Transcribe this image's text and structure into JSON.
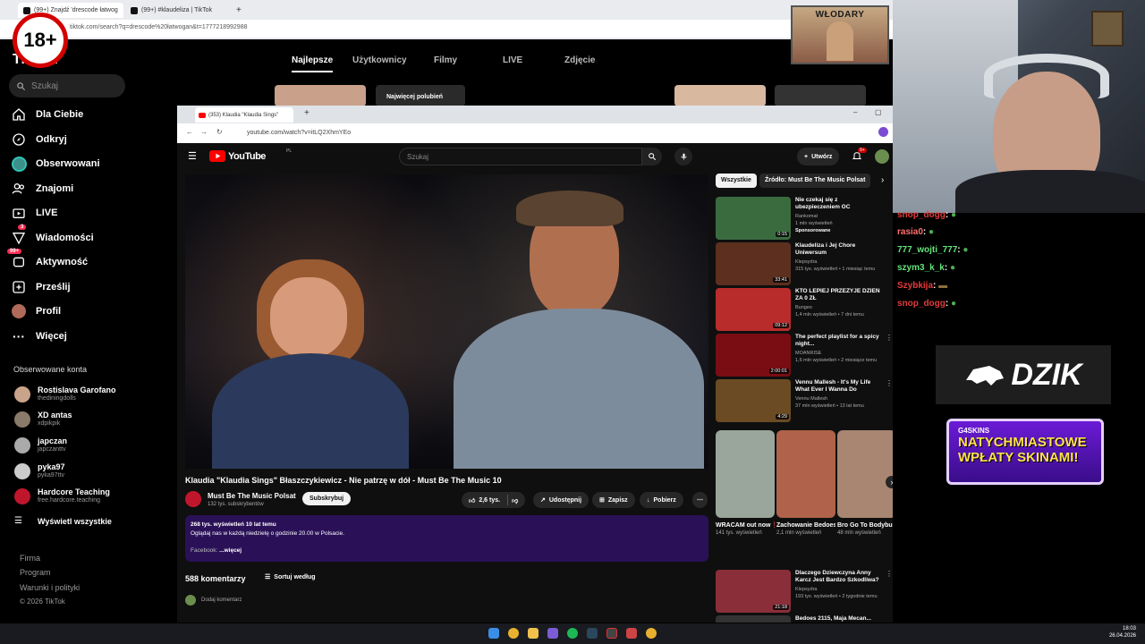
{
  "chrome": {
    "tabs": [
      {
        "label": "(99+) Znajdź 'drescode łatwog"
      },
      {
        "label": "(99+) #klaudeliza | TikTok"
      }
    ],
    "url": "tiktok.com/search?q=drescode%20łatwogan&t=1777218992988"
  },
  "tiktok": {
    "logo": "TikTok",
    "search_placeholder": "Szukaj",
    "nav": [
      {
        "label": "Dla Ciebie"
      },
      {
        "label": "Odkryj"
      },
      {
        "label": "Obserwowani"
      },
      {
        "label": "Znajomi"
      },
      {
        "label": "LIVE"
      },
      {
        "label": "Wiadomości",
        "badge": "3"
      },
      {
        "label": "Aktywność",
        "badge": "99+"
      },
      {
        "label": "Prześlij"
      },
      {
        "label": "Profil"
      },
      {
        "label": "Więcej"
      }
    ],
    "followed_title": "Obserwowane konta",
    "followed": [
      {
        "name": "Rostislava Garofano",
        "handle": "thediningdolls"
      },
      {
        "name": "XD antas",
        "handle": "xdpikpik"
      },
      {
        "name": "japczan",
        "handle": "japczanttv"
      },
      {
        "name": "pyka97",
        "handle": "pyka97ttv"
      },
      {
        "name": "Hardcore Teaching",
        "handle": "free.hardcore.teaching"
      }
    ],
    "show_all": "Wyświetl wszystkie",
    "footer": [
      "Firma",
      "Program",
      "Warunki i polityki",
      "© 2026 TikTok"
    ],
    "tabs": [
      "Najlepsze",
      "Użytkownicy",
      "Filmy",
      "LIVE",
      "Zdjęcie"
    ],
    "thumb_label": "Najwięcej polubień"
  },
  "badge18": "18+",
  "youtube": {
    "tab_label": "(353) Klaudia \"Klaudia Sings\"",
    "url": "youtube.com/watch?v=itLQ2XhmYEo",
    "logo": "YouTube",
    "logo_region": "PL",
    "search_placeholder": "Szukaj",
    "create": "Utwórz",
    "bell_badge": "9+",
    "video_title": "Klaudia \"Klaudia Sings\" Błaszczykiewicz - Nie patrzę w dół - Must Be The Music 10",
    "channel": "Must Be The Music Polsat",
    "subscribers": "132 tys. subskrybentów",
    "subscribe": "Subskrybuj",
    "likes": "2,6 tys.",
    "share": "Udostępnij",
    "save": "Zapisz",
    "download": "Pobierz",
    "desc_meta": "268 tys. wyświetleń  10 lat temu",
    "desc_text": "Oglądaj nas w każdą niedzielę o godzinie 20.00 w Polsacie.",
    "desc_more_prefix": "Facebook:",
    "desc_more": "...więcej",
    "comments": "588 komentarzy",
    "sort": "Sortuj według",
    "add_comment": "Dodaj komentarz",
    "chips": [
      "Wszystkie",
      "Źródło: Must Be The Music Polsat"
    ],
    "recs": [
      {
        "title": "Nie czekaj się z ubezpieczeniem OC",
        "channel": "Rankomat",
        "meta": "1 mln wyświetleń",
        "meta2": "Sponsorowane",
        "dur": "0:15",
        "color": "#3a6b3f"
      },
      {
        "title": "Klaudeliza i Jej Chore Uniwersum",
        "channel": "Klepsydra",
        "meta": "315 tys. wyświetleń • 1 miesiąc temu",
        "meta2": "",
        "dur": "33:41",
        "color": "#5c2f1f"
      },
      {
        "title": "KTO LEPIEJ PRZEŻYJE DZIEŃ ZA 0 ZŁ",
        "channel": "Bungeo",
        "meta": "1,4 mln wyświetleń • 7 dni temu",
        "meta2": "",
        "dur": "09:12",
        "color": "#b92c2c"
      },
      {
        "title": "The perfect playlist for a spicy night...",
        "channel": "MOANRISE",
        "meta": "1,6 mln wyświetleń • 2 miesiące temu",
        "meta2": "",
        "dur": "2:00:01",
        "color": "#7a0d14"
      },
      {
        "title": "Vennu Mallesh - It's My Life What Ever I Wanna Do",
        "channel": "Vennu Mallesh",
        "meta": "37 mln wyświetleń • 13 lat temu",
        "meta2": "",
        "dur": "4:29",
        "color": "#6b4b24"
      },
      {
        "title": "Dlaczego Dziewczyna Anny Karcz Jest Bardzo Szkodliwa?",
        "channel": "Klepsydra",
        "meta": "193 tys. wyświetleń • 2 tygodnie temu",
        "meta2": "",
        "dur": "21:18",
        "color": "#8a2e3a"
      },
      {
        "title": "Bedoes 2115, Maja Mecan...",
        "channel": "",
        "meta": "",
        "meta2": "",
        "dur": "",
        "color": "#333"
      }
    ],
    "shorts": [
      {
        "title": "WRACAM out now ‼️",
        "views": "141 tys. wyświetleń",
        "color": "#9aa59b"
      },
      {
        "title": "Zachowanie Bedoesa ...",
        "views": "2,1 mln wyświetleń",
        "color": "#b0624a"
      },
      {
        "title": "Bro Go To Bodybuildi...",
        "views": "48 mln wyświetleń",
        "color": "#a88672"
      }
    ]
  },
  "chat": [
    {
      "user": "snop_dogg",
      "color": "#e03c3c"
    },
    {
      "user": "rasia0",
      "color": "#ff6f6f"
    },
    {
      "user": "777_wojti_777",
      "color": "#64e37a"
    },
    {
      "user": "szym3_k_k",
      "color": "#64e37a"
    },
    {
      "user": "Szybkija",
      "color": "#e83a3a"
    },
    {
      "user": "snop_dogg",
      "color": "#e03c3c"
    }
  ],
  "banners": {
    "wlodary": "WŁODARY",
    "dzik": "DZIK",
    "g4s_brand": "G4SKINS",
    "g4s_text_1": "NATYCHMIASTOWE",
    "g4s_text_2": "WPŁATY SKINAMI!"
  },
  "taskbar": {
    "time": "18:03",
    "date": "26.04.2026"
  }
}
